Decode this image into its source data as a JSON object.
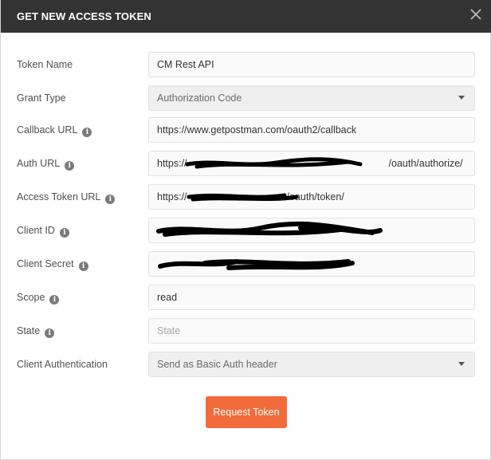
{
  "dialog": {
    "title": "GET NEW ACCESS TOKEN",
    "close_icon": "close-icon"
  },
  "fields": {
    "token_name": {
      "label": "Token Name",
      "value": "CM Rest API"
    },
    "grant_type": {
      "label": "Grant Type",
      "value": "Authorization Code"
    },
    "callback_url": {
      "label": "Callback URL",
      "value": "https://www.getpostman.com/oauth2/callback"
    },
    "auth_url": {
      "label": "Auth URL",
      "prefix": "https://",
      "suffix": "/oauth/authorize/"
    },
    "access_token_url": {
      "label": "Access Token URL",
      "prefix": "https://",
      "suffix": "/oauth/token/"
    },
    "client_id": {
      "label": "Client ID"
    },
    "client_secret": {
      "label": "Client Secret"
    },
    "scope": {
      "label": "Scope",
      "value": "read"
    },
    "state": {
      "label": "State",
      "placeholder": "State"
    },
    "client_authentication": {
      "label": "Client Authentication",
      "value": "Send as Basic Auth header"
    }
  },
  "button": {
    "label": "Request Token"
  },
  "colors": {
    "header_bg": "#333333",
    "accent": "#f26b3a",
    "redaction": "#000000"
  }
}
